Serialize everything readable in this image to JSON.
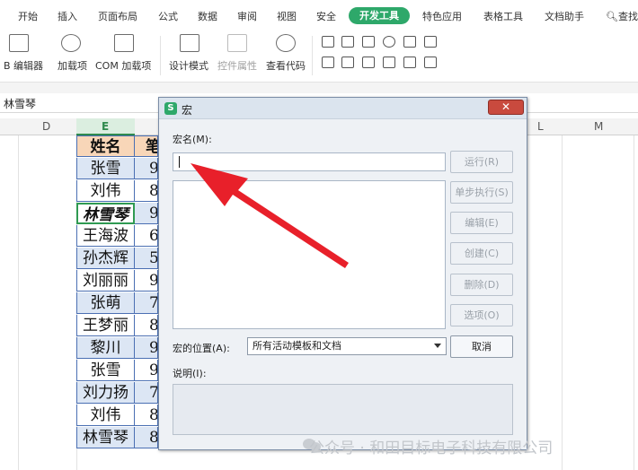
{
  "menu": {
    "items": [
      "开始",
      "插入",
      "页面布局",
      "公式",
      "数据",
      "审阅",
      "视图",
      "安全"
    ],
    "active": "开发工具",
    "after": [
      "特色应用",
      "表格工具",
      "文档助手"
    ],
    "search": "查找"
  },
  "ribbon": {
    "vb_editor": "B 编辑器",
    "addins": "加载项",
    "com_addins": "COM 加载项",
    "design_mode": "设计模式",
    "control_props": "控件属性",
    "view_code": "查看代码"
  },
  "namebox": {
    "value": "林雪琴"
  },
  "sheet": {
    "columns": [
      "D",
      "E",
      "L",
      "M"
    ],
    "header": "姓名",
    "header_f": "笔",
    "rows": [
      {
        "name": "张雪",
        "f": "9"
      },
      {
        "name": "刘伟",
        "f": "8"
      },
      {
        "name": "林雪琴",
        "f": "9"
      },
      {
        "name": "王海波",
        "f": "6"
      },
      {
        "name": "孙杰辉",
        "f": "5"
      },
      {
        "name": "刘丽丽",
        "f": "9"
      },
      {
        "name": "张萌",
        "f": "7"
      },
      {
        "name": "王梦丽",
        "f": "8"
      },
      {
        "name": "黎川",
        "f": "9"
      },
      {
        "name": "张雪",
        "f": "9"
      },
      {
        "name": "刘力扬",
        "f": "7"
      },
      {
        "name": "刘伟",
        "f": "8"
      },
      {
        "name": "林雪琴",
        "f": "8"
      }
    ]
  },
  "dialog": {
    "title": "宏",
    "macro_name_label": "宏名(M):",
    "macro_name_value": "",
    "buttons": {
      "run": "运行(R)",
      "step": "单步执行(S)",
      "edit": "编辑(E)",
      "create": "创建(C)",
      "delete": "删除(D)",
      "options": "选项(O)",
      "cancel": "取消"
    },
    "location_label": "宏的位置(A):",
    "location_value": "所有活动模板和文档",
    "description_label": "说明(I):"
  },
  "watermark": "公众号 · 和田目标电子科技有限公司",
  "colors": {
    "accent": "#2ea86a",
    "header_fill": "#f8d6b8",
    "row_blue": "#dce6f4",
    "arrow": "#e8202a"
  }
}
